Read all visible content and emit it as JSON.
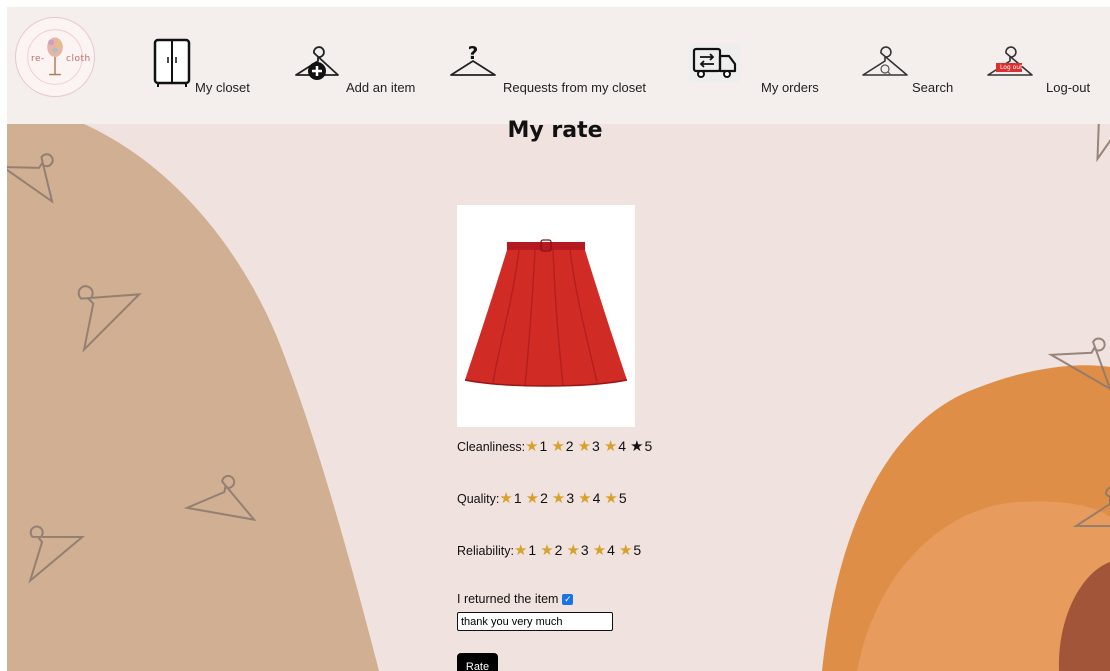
{
  "brand": {
    "logo_text_left": "re-",
    "logo_text_right": "cloth"
  },
  "nav": {
    "my_closet": "My closet",
    "add_item": "Add an item",
    "requests": "Requests from my closet",
    "my_orders": "My orders",
    "search": "Search",
    "logout": "Log-out",
    "logout_badge": "Log out"
  },
  "page": {
    "title": "My rate"
  },
  "ratings": {
    "cleanliness": {
      "label": "Cleanliness:",
      "stars": [
        "1",
        "2",
        "3",
        "4",
        "5"
      ],
      "value": 4
    },
    "quality": {
      "label": "Quality:",
      "stars": [
        "1",
        "2",
        "3",
        "4",
        "5"
      ],
      "value": 5
    },
    "reliability": {
      "label": "Reliability:",
      "stars": [
        "1",
        "2",
        "3",
        "4",
        "5"
      ],
      "value": 5
    }
  },
  "returned": {
    "label": "I returned the item",
    "checked": true
  },
  "comment": {
    "value": "thank you very much"
  },
  "submit": {
    "label": "Rate"
  },
  "colors": {
    "star_active": "#d8a12a",
    "background": "#f0e2df",
    "left_blob": "#d1af93",
    "right_blob": "#e0904a"
  }
}
